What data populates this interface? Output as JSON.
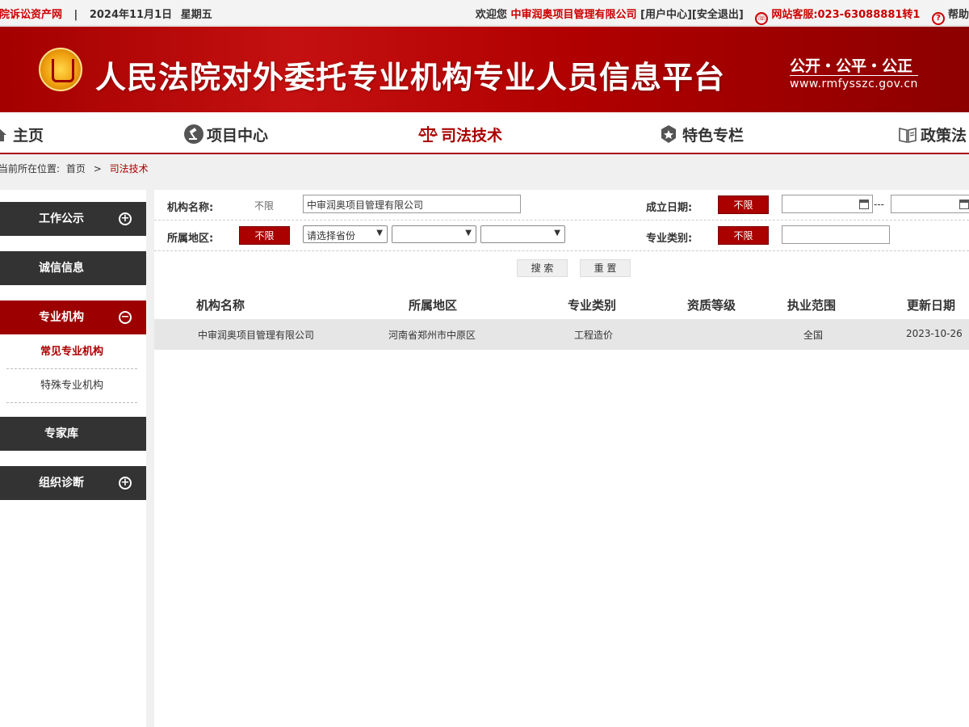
{
  "topbar": {
    "site_name": "法院诉讼资产网",
    "separator": "|",
    "date": "2024年11月1日",
    "weekday": "星期五",
    "welcome": "欢迎您",
    "company": "中审润奥项目管理有限公司",
    "user_center": "[用户中心]",
    "logout": "[安全退出]",
    "hotline": "网站客服:023-63088881转1",
    "help": "帮助"
  },
  "banner": {
    "title": "人民法院对外委托专业机构专业人员信息平台",
    "slogan": "公开・公平・公正",
    "url": "www.rmfysszc.gov.cn"
  },
  "nav": {
    "items": [
      {
        "label": "主页",
        "icon": "home-icon"
      },
      {
        "label": "项目中心",
        "icon": "gavel-icon"
      },
      {
        "label": "司法技术",
        "icon": "scales-icon",
        "active": true
      },
      {
        "label": "特色专栏",
        "icon": "star-badge-icon"
      },
      {
        "label": "政策法",
        "icon": "book-icon"
      }
    ]
  },
  "breadcrumb": {
    "prefix": "当前所在位置:",
    "home": "首页",
    "arrow": ">",
    "current": "司法技术"
  },
  "sidebar": {
    "sections": [
      {
        "label": "工作公示",
        "toggle": "+"
      },
      {
        "label": "诚信信息"
      },
      {
        "label": "专业机构",
        "toggle": "−",
        "active": true
      },
      {
        "label": "专家库"
      },
      {
        "label": "组织诊断",
        "toggle": "+"
      }
    ],
    "sub_items": [
      {
        "label": "常见专业机构",
        "current": true
      },
      {
        "label": "特殊专业机构"
      }
    ]
  },
  "filters": {
    "org_name_label": "机构名称:",
    "org_name_unlimited": "不限",
    "org_name_value": "中审润奥项目管理有限公司",
    "founded_label": "成立日期:",
    "founded_unlimited": "不限",
    "date_separator": "---",
    "region_label": "所属地区:",
    "region_unlimited": "不限",
    "province_select": "请选择省份",
    "category_label": "专业类别:",
    "category_unlimited": "不限"
  },
  "actions": {
    "search": "搜 索",
    "reset": "重 置"
  },
  "table": {
    "headers": [
      "机构名称",
      "所属地区",
      "专业类别",
      "资质等级",
      "执业范围",
      "更新日期"
    ],
    "rows": [
      [
        "中审润奥项目管理有限公司",
        "河南省郑州市中原区",
        "工程造价",
        "",
        "全国",
        "2023-10-26"
      ]
    ]
  },
  "colors": {
    "brand_red": "#aa0000",
    "dark_sidebar": "#333333"
  }
}
